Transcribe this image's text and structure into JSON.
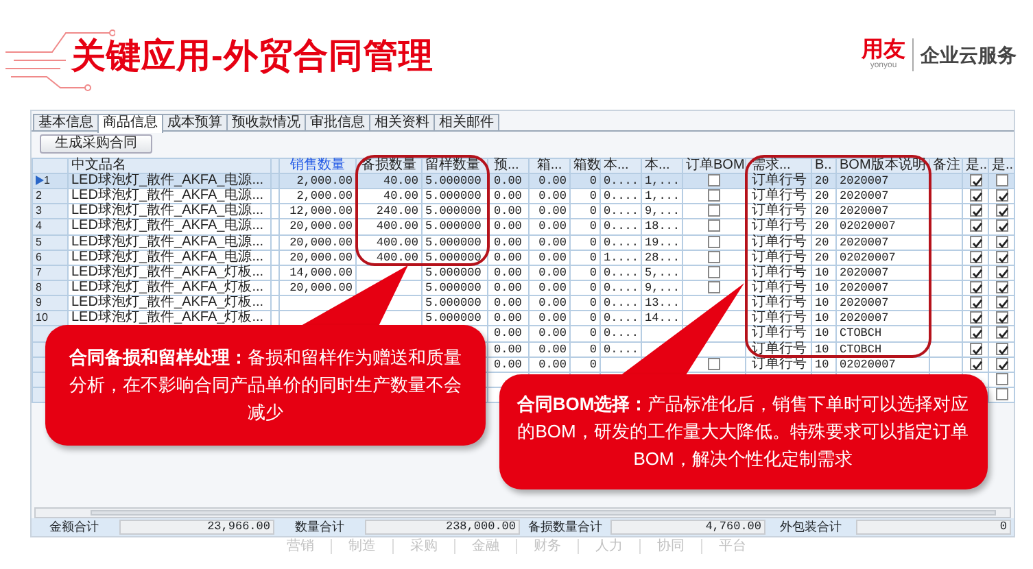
{
  "slide": {
    "title": "关键应用-外贸合同管理",
    "logo": {
      "mark": "用友",
      "sub": "yonyou",
      "tagline": "企业云服务"
    }
  },
  "tabs": [
    {
      "label": "基本信息",
      "selected": false
    },
    {
      "label": "商品信息",
      "selected": true
    },
    {
      "label": "成本预算",
      "selected": false
    },
    {
      "label": "预收款情况",
      "selected": false
    },
    {
      "label": "审批信息",
      "selected": false
    },
    {
      "label": "相关资料",
      "selected": false
    },
    {
      "label": "相关邮件",
      "selected": false
    }
  ],
  "toolbar_button": "生成采购合同",
  "columns": [
    {
      "kind": "rowhead"
    },
    {
      "label": "中文品名",
      "kind": "text",
      "linked": false
    },
    {
      "label": "销售数量",
      "kind": "number",
      "linked": true
    },
    {
      "label": "备损数量",
      "kind": "number",
      "linked": false
    },
    {
      "label": "留样数量",
      "kind": "text",
      "linked": false
    },
    {
      "label": "预...",
      "kind": "text",
      "linked": false
    },
    {
      "label": "箱...",
      "kind": "number",
      "linked": false
    },
    {
      "label": "箱数",
      "kind": "number",
      "linked": false
    },
    {
      "label": "本...",
      "kind": "text",
      "linked": false
    },
    {
      "label": "本...",
      "kind": "text",
      "linked": false
    },
    {
      "label": "订单BOM",
      "kind": "check",
      "linked": false
    },
    {
      "label": "需求...",
      "kind": "text",
      "linked": false
    },
    {
      "label": "B..",
      "kind": "text",
      "linked": false
    },
    {
      "label": "BOM版本说明",
      "kind": "text",
      "linked": false
    },
    {
      "label": "备注",
      "kind": "text",
      "linked": false
    },
    {
      "label": "是..",
      "kind": "check",
      "linked": false
    },
    {
      "label": "是..",
      "kind": "check",
      "linked": false
    }
  ],
  "rows": [
    {
      "selected": true,
      "cells": [
        "1",
        "LED球泡灯_散件_AKFA_电源...",
        "2,000.00",
        "40.00",
        "5.000000",
        "0.00",
        "0.00",
        "0",
        "0....",
        "1,...",
        false,
        "订单行号",
        "20",
        "2020007",
        null,
        true,
        false
      ]
    },
    {
      "selected": false,
      "cells": [
        "2",
        "LED球泡灯_散件_AKFA_电源...",
        "2,000.00",
        "40.00",
        "5.000000",
        "0.00",
        "0.00",
        "0",
        "0....",
        "1,...",
        false,
        "订单行号",
        "20",
        "2020007",
        null,
        true,
        true
      ]
    },
    {
      "selected": false,
      "cells": [
        "3",
        "LED球泡灯_散件_AKFA_电源...",
        "12,000.00",
        "240.00",
        "5.000000",
        "0.00",
        "0.00",
        "0",
        "0....",
        "9,...",
        false,
        "订单行号",
        "20",
        "2020007",
        null,
        true,
        true
      ]
    },
    {
      "selected": false,
      "cells": [
        "4",
        "LED球泡灯_散件_AKFA_电源...",
        "20,000.00",
        "400.00",
        "5.000000",
        "0.00",
        "0.00",
        "0",
        "0....",
        "18...",
        false,
        "订单行号",
        "20",
        "02020007",
        null,
        true,
        true
      ]
    },
    {
      "selected": false,
      "cells": [
        "5",
        "LED球泡灯_散件_AKFA_电源...",
        "20,000.00",
        "400.00",
        "5.000000",
        "0.00",
        "0.00",
        "0",
        "0....",
        "19...",
        false,
        "订单行号",
        "20",
        "2020007",
        null,
        true,
        true
      ]
    },
    {
      "selected": false,
      "cells": [
        "6",
        "LED球泡灯_散件_AKFA_电源...",
        "20,000.00",
        "400.00",
        "5.000000",
        "0.00",
        "0.00",
        "0",
        "1....",
        "28...",
        false,
        "订单行号",
        "20",
        "02020007",
        null,
        true,
        true
      ]
    },
    {
      "selected": false,
      "cells": [
        "7",
        "LED球泡灯_散件_AKFA_灯板...",
        "14,000.00",
        null,
        "5.000000",
        "0.00",
        "0.00",
        "0",
        "0....",
        "5,...",
        false,
        "订单行号",
        "10",
        "2020007",
        null,
        true,
        true
      ]
    },
    {
      "selected": false,
      "cells": [
        "8",
        "LED球泡灯_散件_AKFA_灯板...",
        "20,000.00",
        null,
        "5.000000",
        "0.00",
        "0.00",
        "0",
        "0....",
        "9,...",
        false,
        "订单行号",
        "10",
        "2020007",
        null,
        true,
        true
      ]
    },
    {
      "selected": false,
      "cells": [
        "9",
        "LED球泡灯_散件_AKFA_灯板...",
        null,
        null,
        "5.000000",
        "0.00",
        "0.00",
        "0",
        "0....",
        "13...",
        null,
        "订单行号",
        "10",
        "2020007",
        null,
        true,
        true
      ]
    },
    {
      "selected": false,
      "cells": [
        "10",
        "LED球泡灯_散件_AKFA_灯板...",
        null,
        null,
        "5.000000",
        "0.00",
        "0.00",
        "0",
        "0....",
        "14...",
        null,
        "订单行号",
        "10",
        "2020007",
        null,
        true,
        true
      ]
    },
    {
      "selected": false,
      "cells": [
        null,
        null,
        null,
        null,
        null,
        "0.00",
        "0.00",
        "0",
        "0....",
        null,
        null,
        "订单行号",
        "10",
        "CTOBCH",
        null,
        true,
        true
      ]
    },
    {
      "selected": false,
      "cells": [
        null,
        null,
        null,
        null,
        null,
        "0.00",
        "0.00",
        "0",
        "0....",
        null,
        null,
        "订单行号",
        "10",
        "CTOBCH",
        null,
        true,
        true
      ]
    },
    {
      "selected": false,
      "cells": [
        null,
        null,
        null,
        null,
        null,
        "0.00",
        "0.00",
        "0",
        null,
        null,
        false,
        "订单行号",
        "10",
        "02020007",
        null,
        true,
        true
      ]
    },
    {
      "selected": false,
      "cells": [
        null,
        null,
        null,
        null,
        null,
        null,
        null,
        null,
        null,
        null,
        null,
        null,
        null,
        null,
        null,
        null,
        false
      ]
    },
    {
      "selected": false,
      "cells": [
        null,
        null,
        null,
        null,
        null,
        null,
        null,
        null,
        null,
        null,
        null,
        null,
        null,
        null,
        null,
        null,
        false
      ]
    }
  ],
  "totals": [
    {
      "label": "金额合计",
      "value": "23,966.00"
    },
    {
      "label": "数量合计",
      "value": "238,000.00"
    },
    {
      "label": "备损数量合计",
      "value": "4,760.00"
    },
    {
      "label": "外包装合计",
      "value": "0"
    }
  ],
  "callouts": [
    {
      "text": "**合同备损和留样处理：**备损和留样作为赠送和质量分析，在不影响合同产品单价的同时生产数量不会减少"
    },
    {
      "text": "**合同BOM选择：**产品标准化后，销售下单时可以选择对应的BOM，研发的工作量大大降低。特殊要求可以指定订单BOM，解决个性化定制需求"
    }
  ],
  "footer_nav": [
    "营销",
    "制造",
    "采购",
    "金融",
    "财务",
    "人力",
    "协同",
    "平台"
  ]
}
